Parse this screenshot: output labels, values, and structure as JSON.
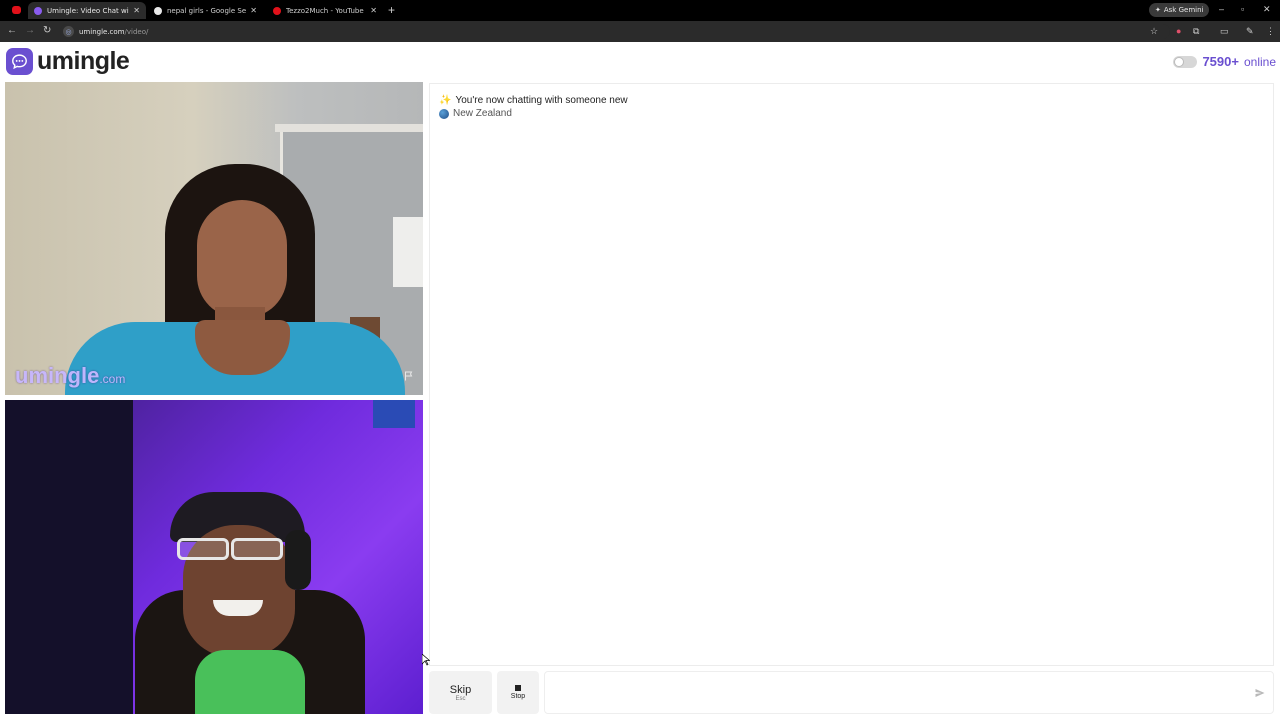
{
  "browser": {
    "tabs": [
      {
        "label": "Umingle: Video Chat with S",
        "active": true
      },
      {
        "label": "nepal girls - Google Search",
        "active": false
      },
      {
        "label": "Tezzo2Much - YouTube",
        "active": false
      }
    ],
    "gemini_label": "Ask Gemini",
    "url_host": "umingle.com",
    "url_path": "/video/"
  },
  "header": {
    "brand": "umingle",
    "online_count": "7590+",
    "online_label": "online"
  },
  "video": {
    "watermark_brand": "umingle",
    "watermark_suffix": ".com"
  },
  "chat": {
    "status_message": "You're now chatting with someone new",
    "country": "New Zealand"
  },
  "controls": {
    "skip_label": "Skip",
    "skip_hint": "Esc",
    "stop_label": "Stop",
    "message_value": ""
  },
  "colors": {
    "brand": "#6a4fd0",
    "chrome_dark": "#000000",
    "toolbar": "#2b2b2b"
  },
  "icons": {
    "logo": "chat-bubble-icon",
    "status": "sparkle-icon",
    "country": "globe-icon",
    "report": "flag-icon",
    "send": "send-icon"
  }
}
